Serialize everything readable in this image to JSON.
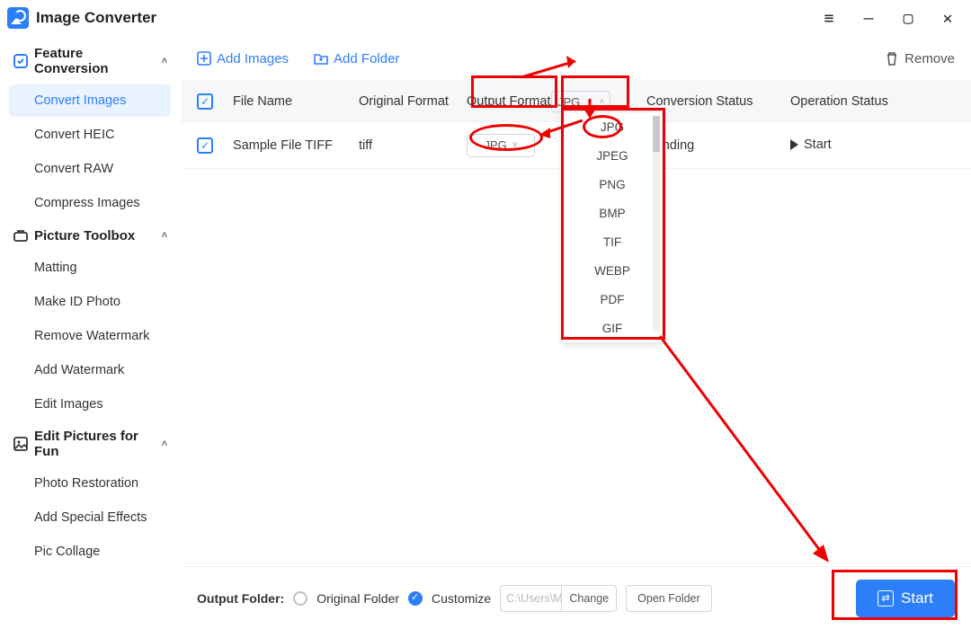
{
  "app": {
    "title": "Image Converter"
  },
  "window_controls": {
    "menu": "≡",
    "min": "—",
    "max": "▢",
    "close": "✕"
  },
  "sidebar": {
    "groups": [
      {
        "icon": "feature-icon",
        "label": "Feature Conversion",
        "items": [
          {
            "label": "Convert Images",
            "active": true
          },
          {
            "label": "Convert HEIC"
          },
          {
            "label": "Convert RAW"
          },
          {
            "label": "Compress Images"
          }
        ]
      },
      {
        "icon": "toolbox-icon",
        "label": "Picture Toolbox",
        "items": [
          {
            "label": "Matting"
          },
          {
            "label": "Make ID Photo"
          },
          {
            "label": "Remove Watermark"
          },
          {
            "label": "Add Watermark"
          },
          {
            "label": "Edit Images"
          }
        ]
      },
      {
        "icon": "fun-icon",
        "label": "Edit Pictures for Fun",
        "items": [
          {
            "label": "Photo Restoration"
          },
          {
            "label": "Add Special Effects"
          },
          {
            "label": "Pic Collage"
          }
        ]
      }
    ]
  },
  "toolbar": {
    "add_images": "Add Images",
    "add_folder": "Add Folder",
    "remove": "Remove"
  },
  "table": {
    "headers": {
      "filename": "File Name",
      "origfmt": "Original Format",
      "outfmt": "Output Format",
      "outfmt_sel": "JPG",
      "convstat": "Conversion Status",
      "opstat": "Operation Status"
    },
    "rows": [
      {
        "filename": "Sample File TIFF",
        "origfmt": "tiff",
        "outfmt": "JPG",
        "convstat": "Pending",
        "op": "Start"
      }
    ]
  },
  "dropdown": {
    "options": [
      "JPG",
      "JPEG",
      "PNG",
      "BMP",
      "TIF",
      "WEBP",
      "PDF",
      "GIF"
    ],
    "selected": "JPG"
  },
  "bottom": {
    "label": "Output Folder:",
    "orig": "Original Folder",
    "custom": "Customize",
    "path": "C:\\Users\\MLoong",
    "change": "Change",
    "open": "Open Folder",
    "start": "Start"
  }
}
